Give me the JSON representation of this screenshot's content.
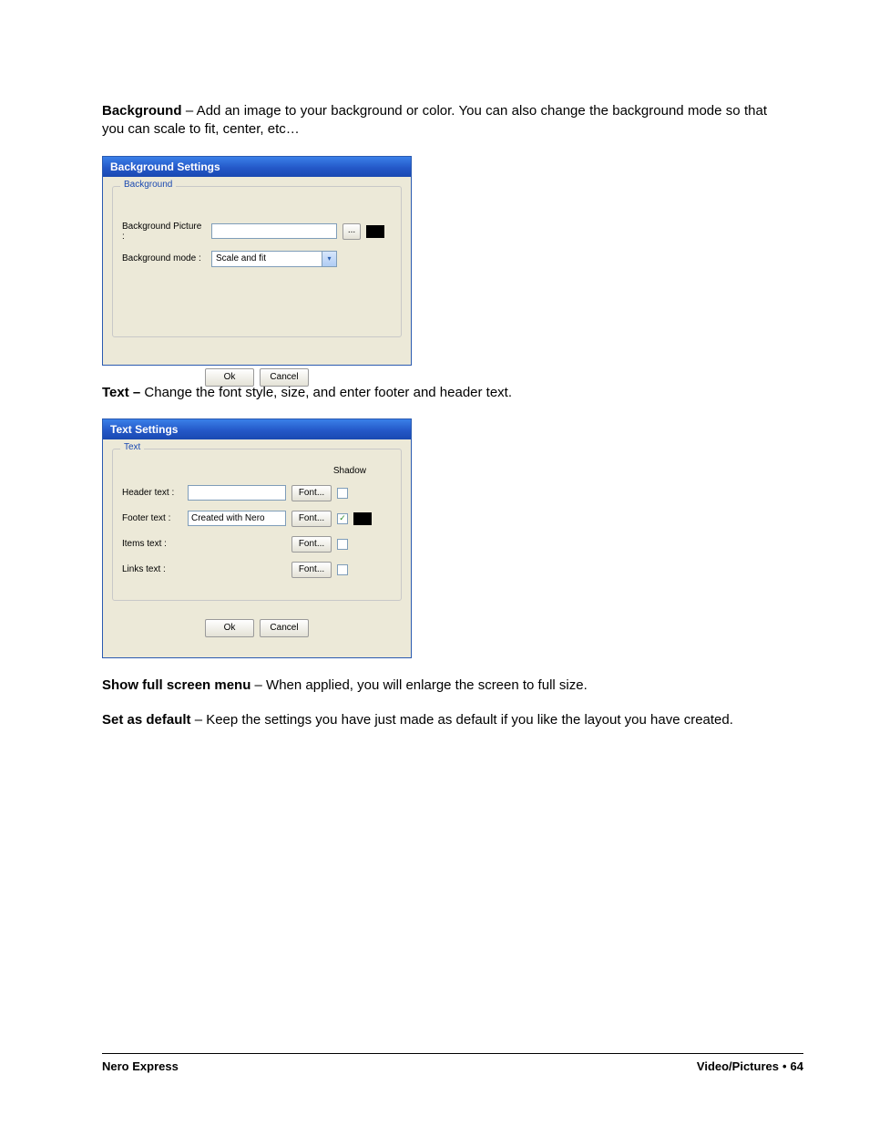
{
  "para1": {
    "bold": "Background",
    "rest": " – Add an image to your background or color. You can also change the background mode so that you can scale to fit, center, etc…"
  },
  "bgDialog": {
    "title": "Background Settings",
    "legend": "Background",
    "pictureLabel": "Background Picture :",
    "pictureValue": "",
    "browse": "...",
    "modeLabel": "Background mode :",
    "modeValue": "Scale and fit",
    "ok": "Ok",
    "cancel": "Cancel"
  },
  "para2": {
    "bold": "Text –",
    "rest": " Change the font style, size, and enter footer and header text."
  },
  "textDialog": {
    "title": "Text Settings",
    "legend": "Text",
    "shadowHeader": "Shadow",
    "headerLabel": "Header text :",
    "headerValue": "",
    "footerLabel": "Footer text :",
    "footerValue": "Created with Nero",
    "itemsLabel": "Items text :",
    "linksLabel": "Links text :",
    "fontBtn": "Font...",
    "ok": "Ok",
    "cancel": "Cancel",
    "footerChecked": "✓"
  },
  "para3": {
    "bold": "Show full screen menu",
    "rest": " – When applied, you will enlarge the screen to full size."
  },
  "para4": {
    "bold": "Set as default",
    "rest": " – Keep the settings you have just made as default if you like the layout you have created."
  },
  "footer": {
    "left": "Nero Express",
    "rightSection": "Video/Pictures",
    "rightPage": "64"
  }
}
